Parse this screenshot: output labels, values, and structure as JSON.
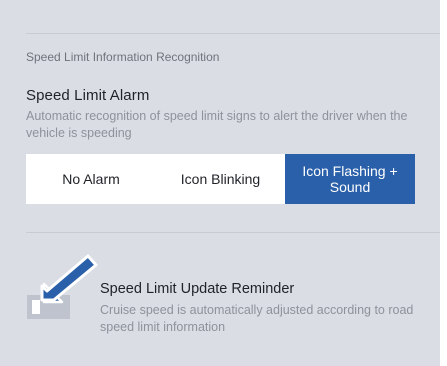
{
  "speed_limit_info": {
    "section_title": "Speed Limit Information Recognition",
    "alarm": {
      "title": "Speed Limit Alarm",
      "description": "Automatic recognition of speed limit signs to alert the driver when the vehicle is speeding",
      "options": [
        {
          "label": "No Alarm",
          "selected": false
        },
        {
          "label": "Icon Blinking",
          "selected": false
        },
        {
          "label": "Icon Flashing + Sound",
          "selected": true
        }
      ]
    }
  },
  "update_reminder": {
    "title": "Speed Limit Update Reminder",
    "description": "Cruise speed is automatically adjusted according to road speed limit information",
    "toggle_on": false
  },
  "pointer": {
    "icon": "arrow-pointer-icon",
    "color": "#2a5fa9"
  },
  "colors": {
    "selected_option": "#2a5fa9",
    "panel_background": "#dadde4",
    "toggle_off": "#bec3cd"
  }
}
